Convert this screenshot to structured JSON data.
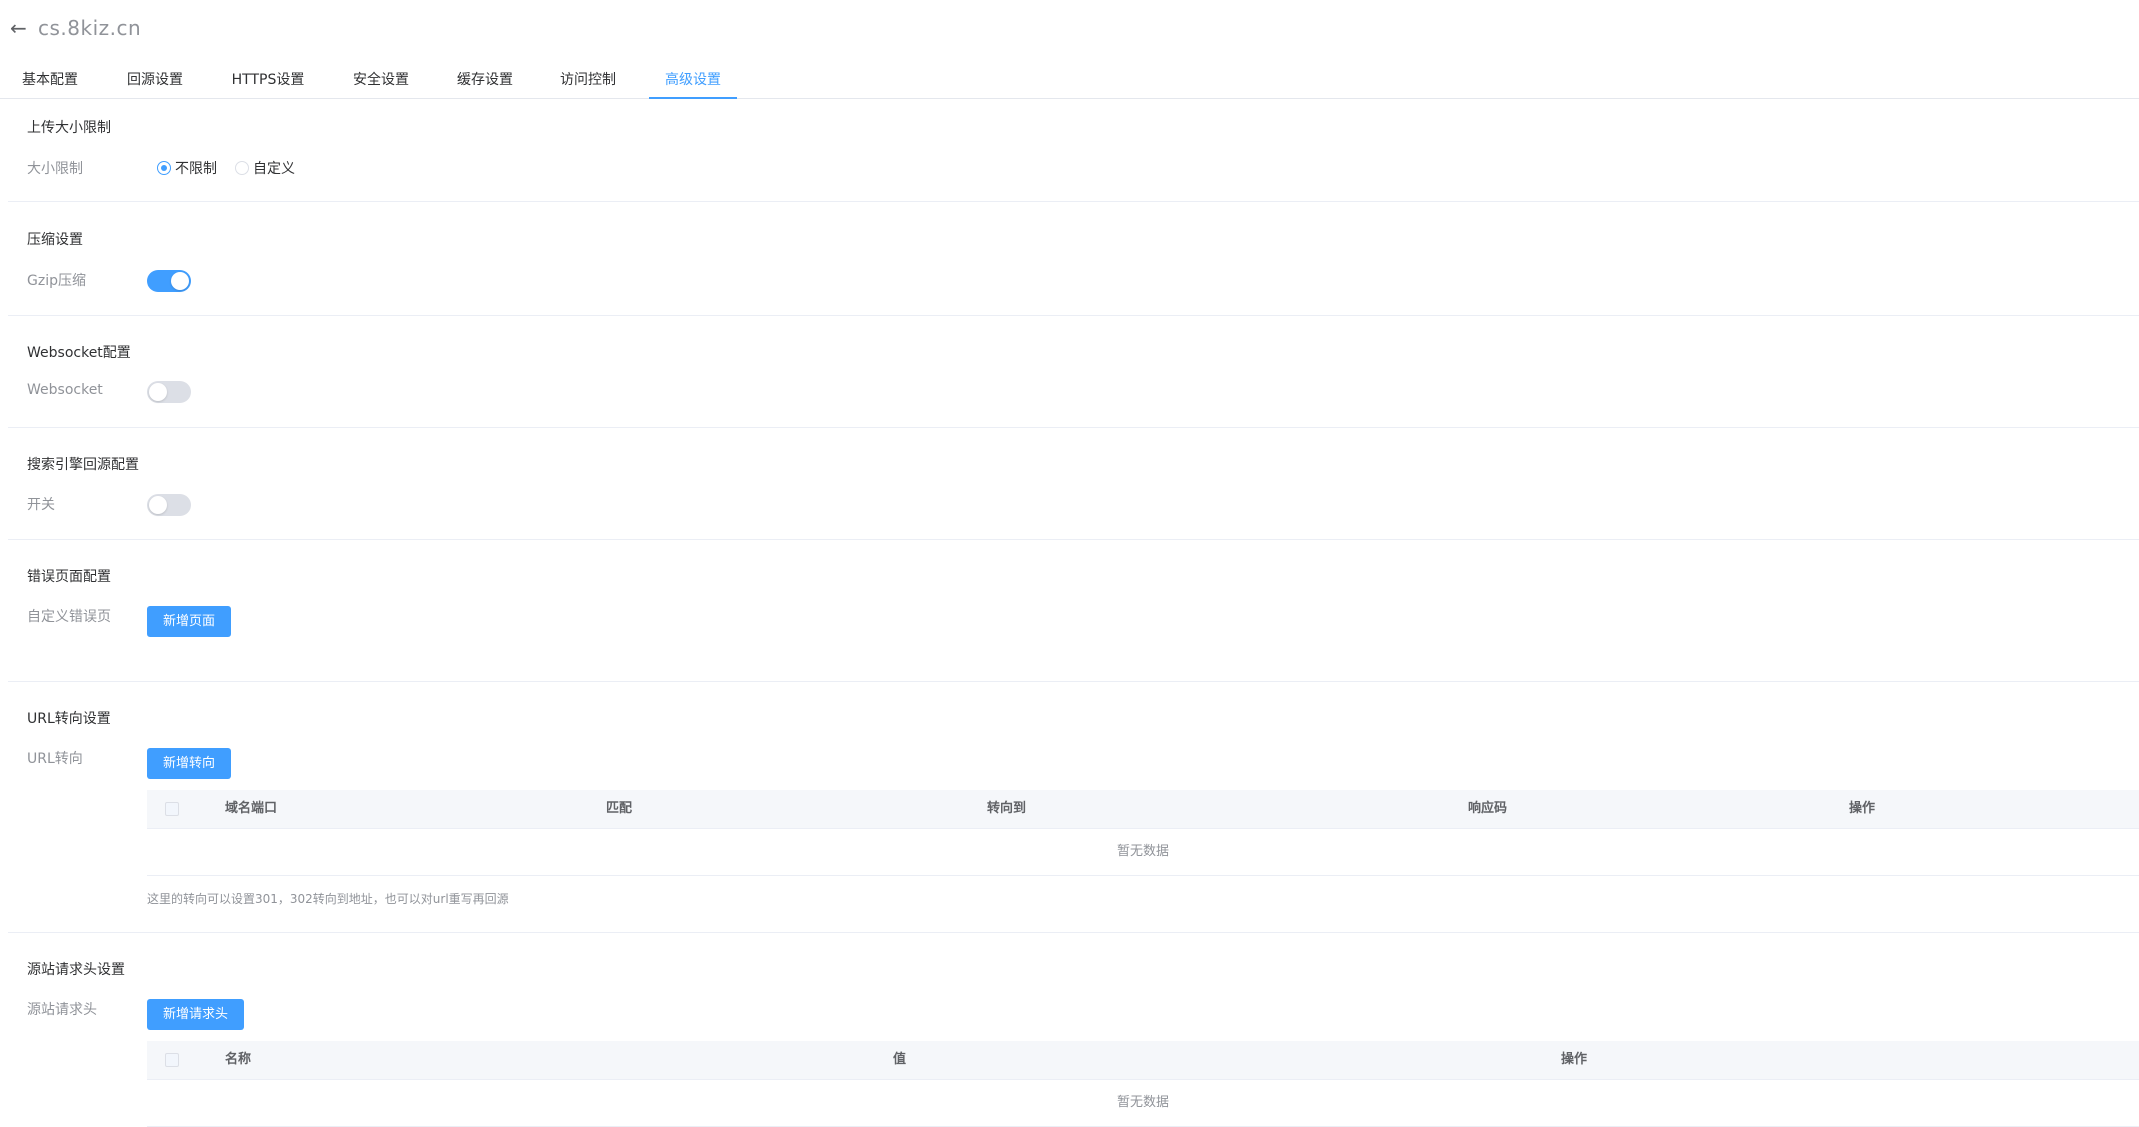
{
  "header": {
    "domain": "cs.8kiz.cn"
  },
  "tabs": [
    {
      "label": "基本配置"
    },
    {
      "label": "回源设置"
    },
    {
      "label": "HTTPS设置"
    },
    {
      "label": "安全设置"
    },
    {
      "label": "缓存设置"
    },
    {
      "label": "访问控制"
    },
    {
      "label": "高级设置"
    }
  ],
  "upload": {
    "title": "上传大小限制",
    "label": "大小限制",
    "options": [
      "不限制",
      "自定义"
    ],
    "selected": "不限制"
  },
  "compress": {
    "title": "压缩设置",
    "label": "Gzip压缩",
    "enabled": true
  },
  "websocket": {
    "title": "Websocket配置",
    "label": "Websocket",
    "enabled": false
  },
  "seo": {
    "title": "搜索引擎回源配置",
    "label": "开关",
    "enabled": false
  },
  "error_page": {
    "title": "错误页面配置",
    "label": "自定义错误页",
    "button": "新增页面"
  },
  "url_redirect": {
    "title": "URL转向设置",
    "label": "URL转向",
    "button": "新增转向",
    "columns": [
      "域名端口",
      "匹配",
      "转向到",
      "响应码",
      "操作"
    ],
    "empty_text": "暂无数据",
    "hint": "这里的转向可以设置301，302转向到地址，也可以对url重写再回源"
  },
  "origin_headers": {
    "title": "源站请求头设置",
    "label": "源站请求头",
    "button": "新增请求头",
    "columns": [
      "名称",
      "值",
      "操作"
    ],
    "empty_text": "暂无数据"
  },
  "colors": {
    "primary": "#409eff",
    "border": "#ebeef5",
    "muted": "#909399"
  }
}
